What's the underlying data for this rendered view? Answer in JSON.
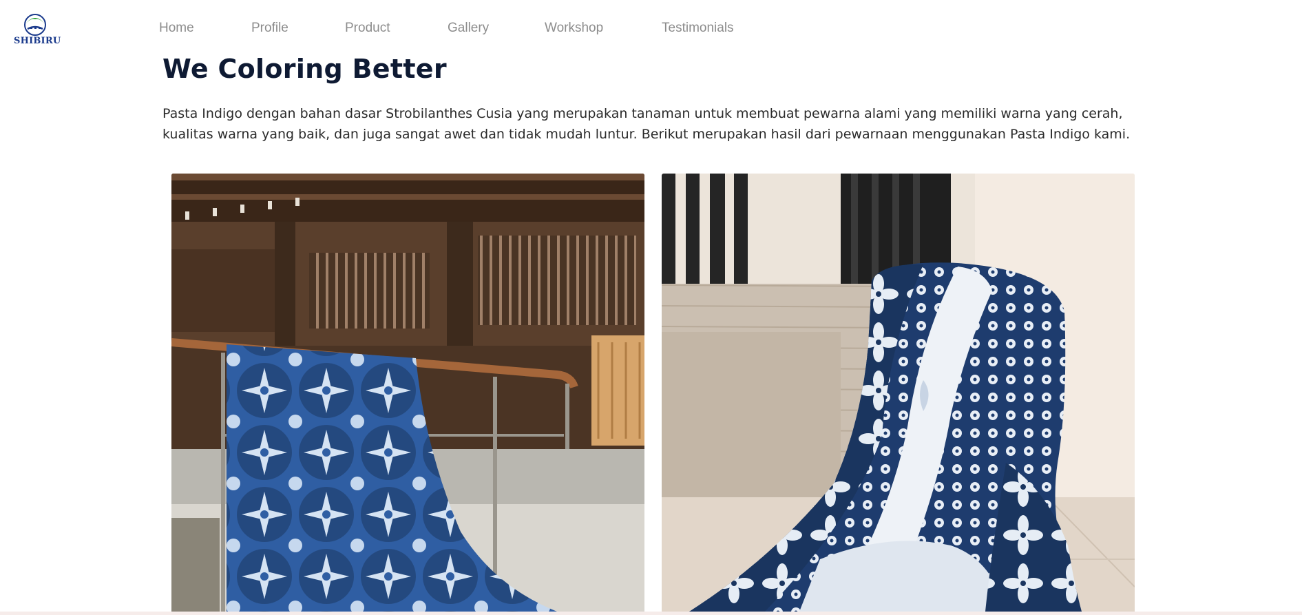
{
  "brand": {
    "name": "SHIBIRU"
  },
  "nav": {
    "items": [
      {
        "label": "Home"
      },
      {
        "label": "Profile"
      },
      {
        "label": "Product"
      },
      {
        "label": "Gallery"
      },
      {
        "label": "Workshop"
      },
      {
        "label": "Testimonials"
      }
    ]
  },
  "section": {
    "title": "We Coloring Better",
    "description": "Pasta Indigo dengan bahan dasar Strobilanthes Cusia yang merupakan tanaman untuk membuat pewarna alami yang memiliki warna yang cerah, kualitas warna yang baik, dan juga sangat awet dan tidak mudah luntur. Berikut merupakan hasil dari pewarnaan menggunakan Pasta Indigo kami."
  },
  "colors": {
    "title": "#0e1a33",
    "nav_text": "#8c8c8c",
    "brand_blue": "#1a3a8c",
    "brand_green": "#2e9e3a",
    "indigo": "#1e3c6e"
  },
  "icons": {
    "logo": "shibiru-logo-icon"
  }
}
